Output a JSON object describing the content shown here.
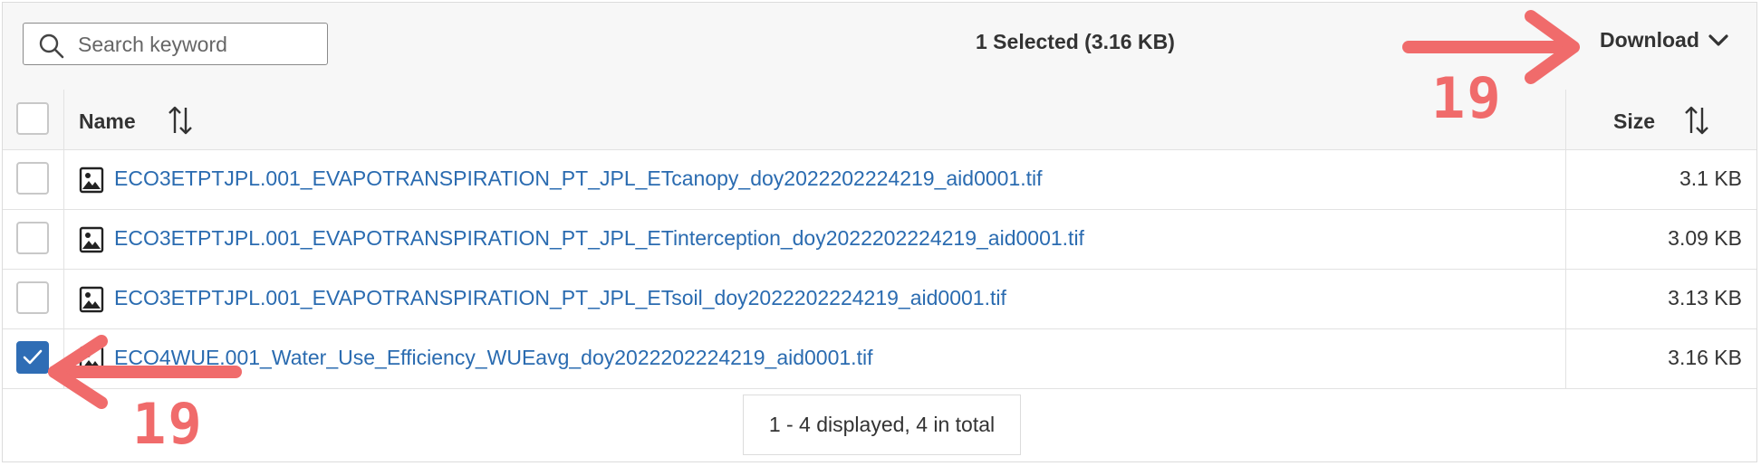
{
  "search": {
    "placeholder": "Search keyword",
    "icon": "search-icon"
  },
  "toolbar": {
    "selected_text": "1 Selected (3.16 KB)",
    "download_label": "Download"
  },
  "table": {
    "headers": {
      "name": "Name",
      "size": "Size"
    },
    "rows": [
      {
        "name": "ECO3ETPTJPL.001_EVAPOTRANSPIRATION_PT_JPL_ETcanopy_doy2022202224219_aid0001.tif",
        "size": "3.1 KB",
        "checked": false
      },
      {
        "name": "ECO3ETPTJPL.001_EVAPOTRANSPIRATION_PT_JPL_ETinterception_doy2022202224219_aid0001.tif",
        "size": "3.09 KB",
        "checked": false
      },
      {
        "name": "ECO3ETPTJPL.001_EVAPOTRANSPIRATION_PT_JPL_ETsoil_doy2022202224219_aid0001.tif",
        "size": "3.13 KB",
        "checked": false
      },
      {
        "name": "ECO4WUE.001_Water_Use_Efficiency_WUEavg_doy2022202224219_aid0001.tif",
        "size": "3.16 KB",
        "checked": true
      }
    ]
  },
  "pagination": {
    "text": "1 - 4 displayed, 4 in total"
  },
  "annotations": {
    "download_step": "19",
    "checkbox_step": "19",
    "color": "#f06b6b"
  },
  "colors": {
    "link": "#2a6bb0",
    "checkbox_checked": "#2f6db5",
    "header_bg": "#f7f7f7"
  }
}
